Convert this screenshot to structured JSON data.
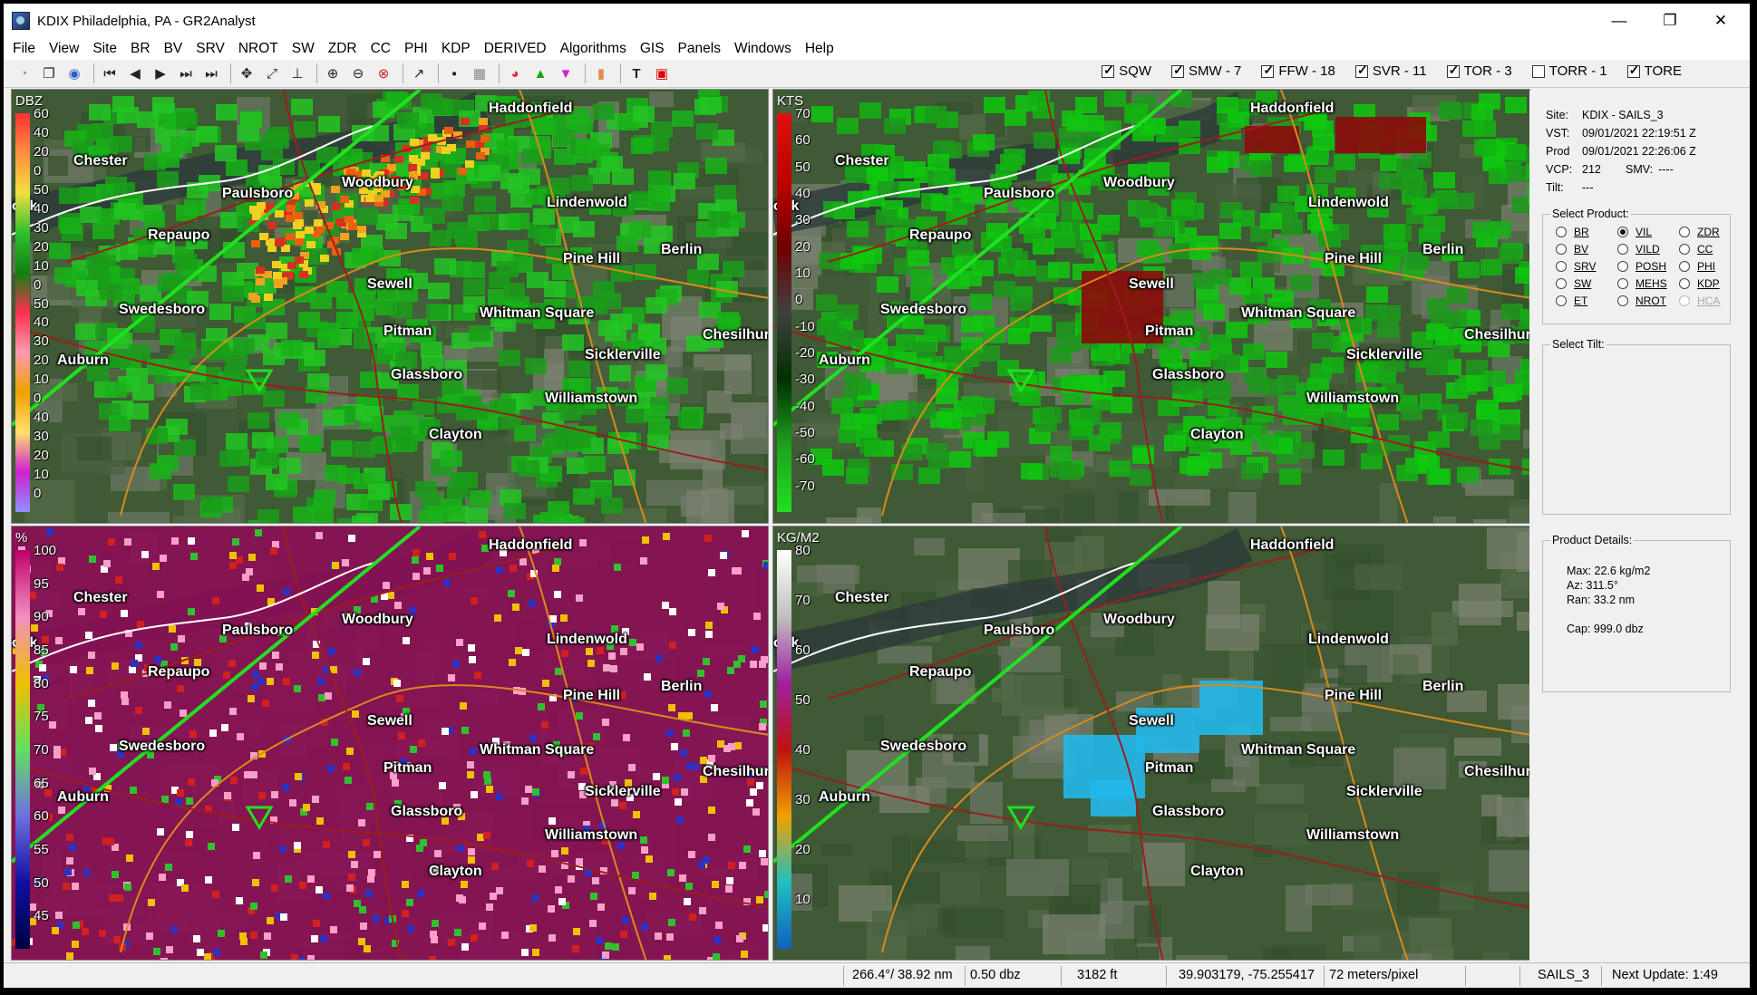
{
  "window": {
    "title": "KDIX Philadelphia, PA - GR2Analyst",
    "minimize": "—",
    "maximize": "❐",
    "close": "✕"
  },
  "menu": [
    "File",
    "View",
    "Site",
    "BR",
    "BV",
    "SRV",
    "NROT",
    "SW",
    "ZDR",
    "CC",
    "PHI",
    "KDP",
    "DERIVED",
    "Algorithms",
    "GIS",
    "Panels",
    "Windows",
    "Help"
  ],
  "warnings": [
    {
      "label": "SQW",
      "checked": true
    },
    {
      "label": "SMW - 7",
      "checked": true
    },
    {
      "label": "FFW - 18",
      "checked": true
    },
    {
      "label": "SVR - 11",
      "checked": true
    },
    {
      "label": "TOR - 3",
      "checked": true
    },
    {
      "label": "TORR - 1",
      "checked": false
    },
    {
      "label": "TORE",
      "checked": true
    }
  ],
  "cities": {
    "haddonfield": "Haddonfield",
    "chester": "Chester",
    "paulsboro": "Paulsboro",
    "woodbury": "Woodbury",
    "lindenwold": "Lindenwold",
    "repaupo": "Repaupo",
    "pinehill": "Pine Hill",
    "berlin": "Berlin",
    "sewell": "Sewell",
    "swedesboro": "Swedesboro",
    "whitman": "Whitman Square",
    "pitman": "Pitman",
    "chesilhurst": "Chesilhurs",
    "auburn": "Auburn",
    "sicklerville": "Sicklerville",
    "glassboro": "Glassboro",
    "williamstown": "Williamstown",
    "clayton": "Clayton",
    "brook": "ook"
  },
  "panels": {
    "p1": {
      "unit": "DBZ",
      "ticks": [
        "60",
        "40",
        "20",
        "0",
        "50",
        "40",
        "30",
        "20",
        "10",
        "0",
        "50",
        "40",
        "30",
        "20",
        "10",
        "0",
        "40",
        "30",
        "20",
        "10",
        "0"
      ]
    },
    "p2": {
      "unit": "KTS",
      "ticks": [
        "70",
        "60",
        "50",
        "40",
        "30",
        "20",
        "10",
        "0",
        "-10",
        "-20",
        "-30",
        "-40",
        "-50",
        "-60",
        "-70"
      ]
    },
    "p3": {
      "unit": "%",
      "ticks": [
        "100",
        "95",
        "90",
        "85",
        "80",
        "75",
        "70",
        "65",
        "60",
        "55",
        "50",
        "45"
      ]
    },
    "p4": {
      "unit": "KG/M2",
      "ticks": [
        "80",
        "70",
        "60",
        "50",
        "40",
        "30",
        "20",
        "10"
      ]
    }
  },
  "site_info": {
    "site_k": "Site:",
    "site_v": "KDIX - SAILS_3",
    "vst_k": "VST:",
    "vst_v": "09/01/2021  22:19:51 Z",
    "prod_k": "Prod",
    "prod_v": "09/01/2021  22:26:06 Z",
    "vcp_k": "VCP:",
    "vcp_v": "212",
    "smv_k": "SMV:",
    "smv_v": "----",
    "tilt_k": "Tilt:",
    "tilt_v": "---"
  },
  "select_product": {
    "title": "Select Product:",
    "options": [
      {
        "label": "BR",
        "selected": false,
        "enabled": true
      },
      {
        "label": "VIL",
        "selected": true,
        "enabled": true
      },
      {
        "label": "ZDR",
        "selected": false,
        "enabled": true
      },
      {
        "label": "BV",
        "selected": false,
        "enabled": true
      },
      {
        "label": "VILD",
        "selected": false,
        "enabled": true
      },
      {
        "label": "CC",
        "selected": false,
        "enabled": true
      },
      {
        "label": "SRV",
        "selected": false,
        "enabled": true
      },
      {
        "label": "POSH",
        "selected": false,
        "enabled": true
      },
      {
        "label": "PHI",
        "selected": false,
        "enabled": true
      },
      {
        "label": "SW",
        "selected": false,
        "enabled": true
      },
      {
        "label": "MEHS",
        "selected": false,
        "enabled": true
      },
      {
        "label": "KDP",
        "selected": false,
        "enabled": true
      },
      {
        "label": "ET",
        "selected": false,
        "enabled": true
      },
      {
        "label": "NROT",
        "selected": false,
        "enabled": true
      },
      {
        "label": "HCA",
        "selected": false,
        "enabled": false
      }
    ]
  },
  "select_tilt": {
    "title": "Select Tilt:"
  },
  "product_details": {
    "title": "Product Details:",
    "max": "Max:   22.6 kg/m2",
    "az": "Az:    311.5°",
    "ran": "Ran:   33.2 nm",
    "cap": "Cap:   999.0 dbz"
  },
  "status": {
    "azran": "266.4°/ 38.92 nm",
    "value": "0.50 dbz",
    "height": "3182 ft",
    "coords": "39.903179, -75.255417",
    "res": "72 meters/pixel",
    "mode": "SAILS_3",
    "next": "Next Update: 1:49"
  }
}
